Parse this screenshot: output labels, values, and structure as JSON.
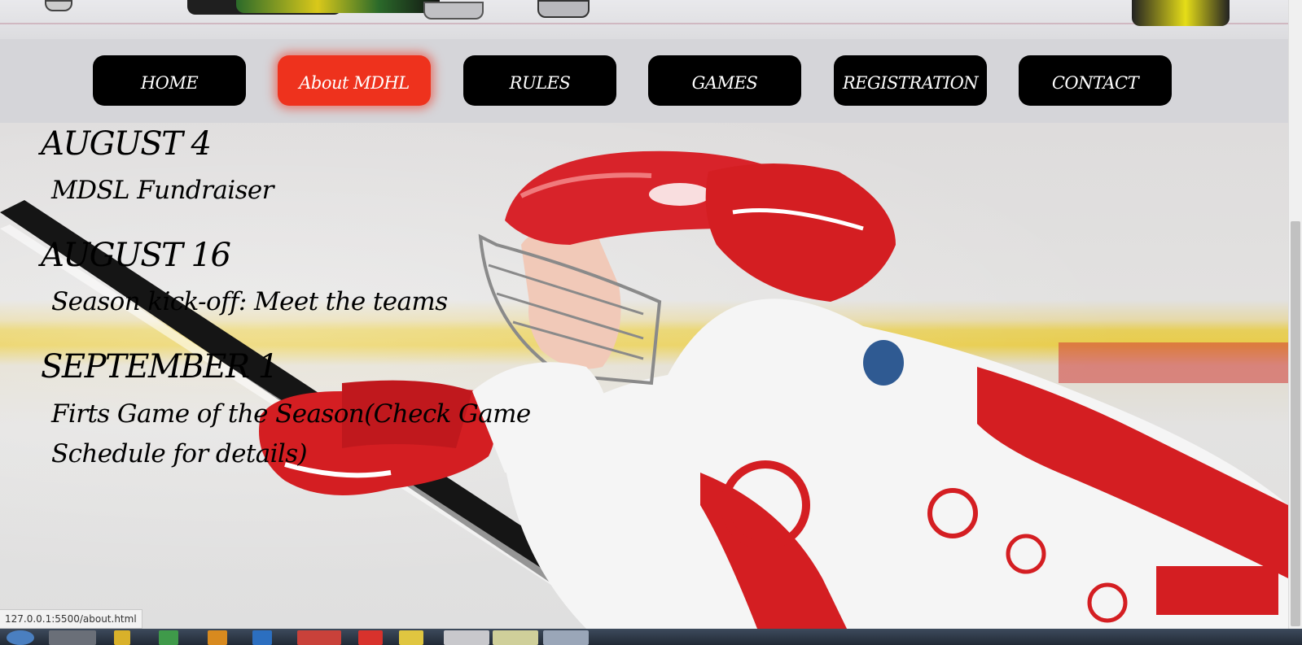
{
  "nav": {
    "items": [
      {
        "label": "HOME",
        "active": false
      },
      {
        "label": "About MDHL",
        "active": true
      },
      {
        "label": "RULES",
        "active": false
      },
      {
        "label": "GAMES",
        "active": false
      },
      {
        "label": "REGISTRATION",
        "active": false
      },
      {
        "label": "CONTACT",
        "active": false
      }
    ]
  },
  "events": [
    {
      "date": "AUGUST 4",
      "description": "MDSL Fundraiser"
    },
    {
      "date": "AUGUST 16",
      "description": "Season kick-off: Meet the teams"
    },
    {
      "date": "SEPTEMBER 1",
      "description": "Firts Game of the Season(Check Game Schedule for details)"
    }
  ],
  "status_bar": {
    "url": "127.0.0.1:5500/about.html"
  },
  "colors": {
    "nav_button": "#000000",
    "nav_active": "#ee321d",
    "nav_bar": "#d5d5d9"
  }
}
